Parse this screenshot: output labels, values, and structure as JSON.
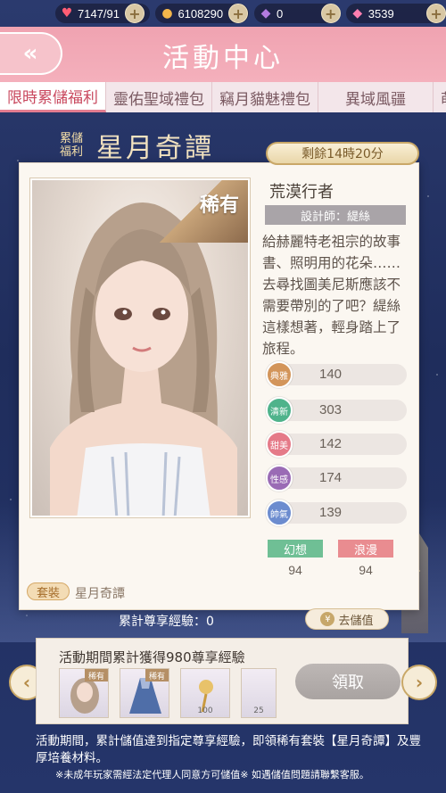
{
  "topbar": {
    "stamina": "7147/91",
    "gold": "6108290",
    "diamond_purple": "0",
    "diamond_pink": "3539"
  },
  "header": {
    "back_label": "«",
    "title": "活動中心"
  },
  "tabs": [
    "限時累儲福利",
    "靈佑聖域禮包",
    "竊月貓魅禮包",
    "異域風疆",
    "萌蘭"
  ],
  "banner": {
    "small": "累儲\n福利",
    "title": "星月奇譚"
  },
  "card": {
    "time_left": "剩餘14時20分",
    "rarity": "稀有",
    "name": "荒漠行者",
    "designer": "設計師：緹絲",
    "description": "給赫麗特老祖宗的故事書、照明用的花朵……去尋找圖美尼斯應該不需要帶別的了吧？緹絲這樣想著，輕身踏上了旅程。",
    "stats": [
      {
        "label": "典雅",
        "value": "140"
      },
      {
        "label": "清新",
        "value": "303"
      },
      {
        "label": "甜美",
        "value": "142"
      },
      {
        "label": "性感",
        "value": "174"
      },
      {
        "label": "帥氣",
        "value": "139"
      }
    ],
    "tags": [
      {
        "label": "幻想",
        "value": "94"
      },
      {
        "label": "浪漫",
        "value": "94"
      }
    ],
    "suit_tag": "套裝",
    "suit_name": "星月奇譚"
  },
  "exp": {
    "label": "累計尊享經驗：0",
    "recharge": "去儲值",
    "coin": "¥"
  },
  "reward": {
    "title": "活動期間累計獲得980尊享經驗",
    "items": [
      {
        "tag": "稀有",
        "count": ""
      },
      {
        "tag": "稀有",
        "count": ""
      },
      {
        "tag": "",
        "count": "100"
      },
      {
        "tag": "",
        "count": "25"
      }
    ],
    "claim": "領取"
  },
  "footer": {
    "desc": "活動期間，累計儲值達到指定尊享經驗，即領稀有套裝【星月奇譚】及豐厚培養材料。",
    "note": "※未成年玩家需經法定代理人同意方可儲值※ 如遇儲值問題請聯繫客服。"
  },
  "colors": {
    "header_pink": "#f0a3b1",
    "stat_elegant": "#d3955a",
    "stat_fresh": "#4fb38b",
    "stat_sweet": "#e57a88",
    "stat_sexy": "#9a6bb5",
    "stat_cool": "#6c8ccf",
    "tag_fantasy": "#6fbf95",
    "tag_romance": "#e98c90"
  }
}
